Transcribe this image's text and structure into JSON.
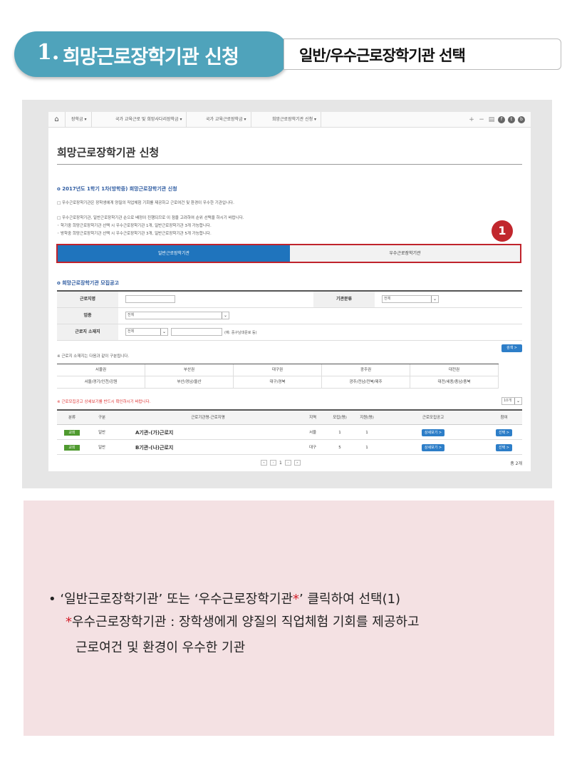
{
  "header": {
    "number": "1.",
    "title": "희망근로장학기관 신청",
    "subtitle": "일반/우수근로장학기관 선택"
  },
  "screenshot": {
    "nav": {
      "items": [
        "장학금",
        "국가 교육근로 및 희망사다리장학금",
        "국가 교육근로장학금",
        "희망근로장학기관 신청"
      ],
      "dropdown_glyph": "▾",
      "icons": [
        "plus-icon",
        "minus-icon",
        "print-icon",
        "facebook-icon",
        "twitter-icon",
        "blog-icon"
      ]
    },
    "page_title": "희망근로장학기관 신청",
    "section1_title": "o 2017년도 1학기 1차(방학중) 희망근로장학기관 신청",
    "notes": [
      "□ 우수근로장학기관은 장학생에게 양질의 직업체험 기회를 제공하고 근로여건 및 환경이 우수한 기관입니다.",
      "□ 우수근로장학기관, 일반근로장학기관 순으로 배정이 진행되므로 이 점을 고려하여 순위 선택을 하시기 바랍니다.",
      "  ◦ 학기중 희망근로장학기관 선택 시 우수근로장학기관 1개, 일반근로장학기관 3개 가능합니다.",
      "  ◦ 방학중 희망근로장학기관 선택 시 우수근로장학기관 3개, 일반근로장학기관 5개 가능합니다."
    ],
    "tabs": {
      "general": "일반근로장학기관",
      "excellent": "우수근로장학기관"
    },
    "badge": "1",
    "section2_title": "o 희망근로장학기관 모집공고",
    "form": {
      "workplace_label": "근로지명",
      "org_type_label": "기관분류",
      "org_type_value": "전체",
      "industry_label": "업종",
      "industry_value": "전체",
      "location_label": "근로지 소재지",
      "location_value": "전체",
      "location_hint": "(예: 중구남대문로 등)",
      "search_button": "검색 >"
    },
    "region_note": "※ 근로지 소재지는 다음과 같이 구분됩니다.",
    "regions": {
      "headers": [
        "서울권",
        "부산권",
        "대구권",
        "광주권",
        "대전권"
      ],
      "values": [
        "서울/경기/인천/강원",
        "부산/경남/울산",
        "대구/경북",
        "광주/전남/전북/제주",
        "대전/세종/충남/충북"
      ]
    },
    "notice_red": "※ 근로모집공고 상세보기를 반드시 확인하시기 바랍니다.",
    "page_size": "10개",
    "results": {
      "headers": [
        "분류",
        "구분",
        "근로기관명-근로지명",
        "지역",
        "모집(명)",
        "지원(명)",
        "근로모집공고",
        "참여"
      ],
      "rows": [
        {
          "category": "교외",
          "type": "일반",
          "name": "A기관-(가)근로지",
          "region": "서울",
          "recruit": "1",
          "applied": "1",
          "detail": "상세보기 >",
          "join": "선택 >"
        },
        {
          "category": "교외",
          "type": "일반",
          "name": "B기관-(나)근로지",
          "region": "대구",
          "recruit": "5",
          "applied": "1",
          "detail": "상세보기 >",
          "join": "선택 >"
        }
      ]
    },
    "pager": {
      "first": "«",
      "prev": "‹",
      "page": "1",
      "next": "›",
      "last": "»"
    },
    "total": "총 2개"
  },
  "info": {
    "bullet": "•",
    "line1_a": "‘일반근로장학기관’ 또는 ‘우수근로장학기관",
    "line1_star": "*",
    "line1_b": "’ 클릭하여 선택(1)",
    "line2_star": "*",
    "line2": "우수근로장학기관 : 장학생에게 양질의 직업체험 기회를 제공하고",
    "line3": "근로여건 및 환경이 우수한 기관"
  },
  "colors": {
    "banner": "#4fa3bb",
    "tab_active": "#1f74bd",
    "highlight_border": "#c0232c",
    "info_bg": "#f4e1e3",
    "star": "#d31f2b"
  }
}
